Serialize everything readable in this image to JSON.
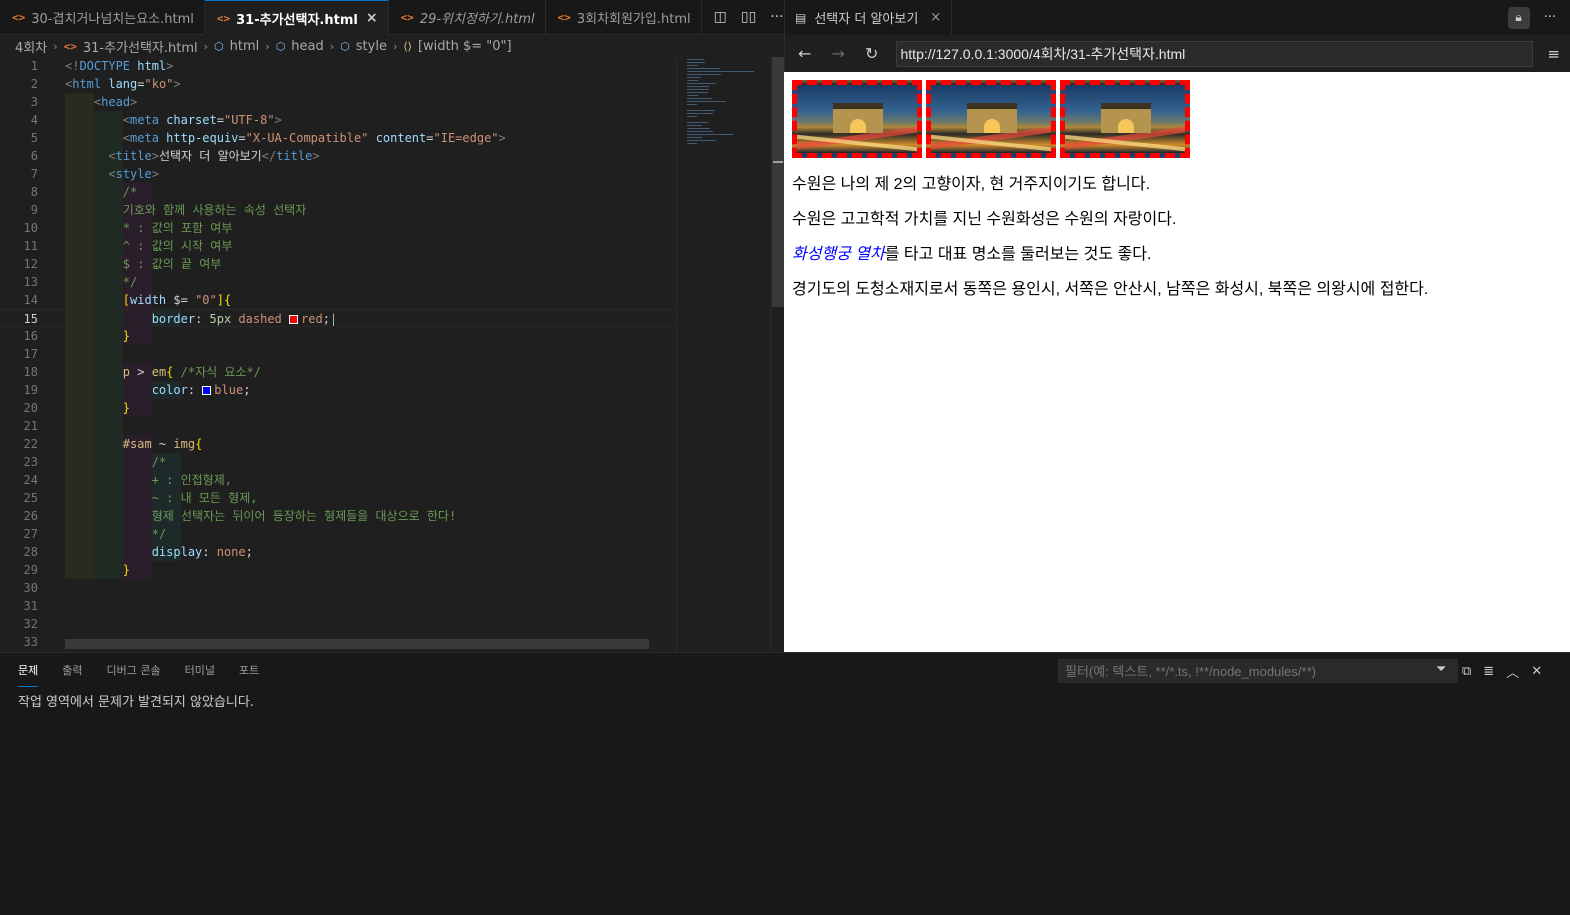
{
  "editor": {
    "tabs": [
      {
        "label": "30-겹치거나넘치는요소.html",
        "active": false,
        "preview": false
      },
      {
        "label": "31-추가선택자.html",
        "active": true,
        "preview": false
      },
      {
        "label": "29-위치정하기.html",
        "active": false,
        "preview": true
      },
      {
        "label": "3회차회원가입.html",
        "active": false,
        "preview": false
      }
    ],
    "tab_icon": "<>",
    "close_glyph": "×",
    "actions": [
      "◫",
      "▯▯",
      "···"
    ],
    "breadcrumb": {
      "folder": "4회차",
      "file": "31-추가선택자.html",
      "html": "html",
      "head": "head",
      "style": "style",
      "selector": "[width $= \"0\"]"
    },
    "current_line": 15,
    "code_lines": [
      [
        [
          "c-punct",
          "<!"
        ],
        [
          "c-tag",
          "DOCTYPE "
        ],
        [
          "c-attr",
          "html"
        ],
        [
          "c-punct",
          ">"
        ]
      ],
      [
        [
          "c-punct",
          "<"
        ],
        [
          "c-tag",
          "html "
        ],
        [
          "c-attr",
          "lang"
        ],
        [
          "c-text",
          "="
        ],
        [
          "c-str",
          "\"ko\""
        ],
        [
          "c-punct",
          ">"
        ]
      ],
      [
        [
          "c-text",
          "    "
        ],
        [
          "c-punct",
          "<"
        ],
        [
          "c-tag",
          "head"
        ],
        [
          "c-punct",
          ">"
        ]
      ],
      [
        [
          "c-text",
          "        "
        ],
        [
          "c-punct",
          "<"
        ],
        [
          "c-tag",
          "meta "
        ],
        [
          "c-attr",
          "charset"
        ],
        [
          "c-text",
          "="
        ],
        [
          "c-str",
          "\"UTF-8\""
        ],
        [
          "c-punct",
          ">"
        ]
      ],
      [
        [
          "c-text",
          "        "
        ],
        [
          "c-punct",
          "<"
        ],
        [
          "c-tag",
          "meta "
        ],
        [
          "c-attr",
          "http-equiv"
        ],
        [
          "c-text",
          "="
        ],
        [
          "c-str",
          "\"X-UA-Compatible\" "
        ],
        [
          "c-attr",
          "content"
        ],
        [
          "c-text",
          "="
        ],
        [
          "c-str",
          "\"IE=edge\""
        ],
        [
          "c-punct",
          ">"
        ]
      ],
      [
        [
          "c-text",
          "      "
        ],
        [
          "c-punct",
          "<"
        ],
        [
          "c-tag",
          "title"
        ],
        [
          "c-punct",
          ">"
        ],
        [
          "c-text",
          "선택자 더 알아보기"
        ],
        [
          "c-punct",
          "</"
        ],
        [
          "c-tag",
          "title"
        ],
        [
          "c-punct",
          ">"
        ]
      ],
      [
        [
          "c-text",
          "      "
        ],
        [
          "c-punct",
          "<"
        ],
        [
          "c-tag",
          "style"
        ],
        [
          "c-punct",
          ">"
        ]
      ],
      [
        [
          "c-text",
          "        "
        ],
        [
          "c-comment",
          "/*"
        ]
      ],
      [
        [
          "c-text",
          "        "
        ],
        [
          "c-comment",
          "기호와 함께 사용하는 속성 선택자"
        ]
      ],
      [
        [
          "c-text",
          "        "
        ],
        [
          "c-comment",
          "* : 값의 포함 여부"
        ]
      ],
      [
        [
          "c-text",
          "        "
        ],
        [
          "c-comment",
          "^ : 값의 시작 여부"
        ]
      ],
      [
        [
          "c-text",
          "        "
        ],
        [
          "c-comment",
          "$ : 값의 끝 여부"
        ]
      ],
      [
        [
          "c-text",
          "        "
        ],
        [
          "c-comment",
          "*/"
        ]
      ],
      [
        [
          "c-text",
          "        "
        ],
        [
          "c-brace",
          "["
        ],
        [
          "c-attr",
          "width"
        ],
        [
          "c-text",
          " $= "
        ],
        [
          "c-str",
          "\"0\""
        ],
        [
          "c-brace",
          "]{"
        ]
      ],
      [
        [
          "c-text",
          "            "
        ],
        [
          "c-prop",
          "border"
        ],
        [
          "c-text",
          ": "
        ],
        [
          "c-num",
          "5px "
        ],
        [
          "c-str",
          "dashed "
        ],
        [
          "swatch-red",
          ""
        ],
        [
          "c-str",
          "red"
        ],
        [
          "c-text",
          ";"
        ]
      ],
      [
        [
          "c-text",
          "        "
        ],
        [
          "c-brace",
          "}"
        ]
      ],
      [],
      [
        [
          "c-text",
          "        "
        ],
        [
          "c-sel",
          "p"
        ],
        [
          "c-text",
          " > "
        ],
        [
          "c-sel",
          "em"
        ],
        [
          "c-brace",
          "{ "
        ],
        [
          "c-comment",
          "/*자식 요소*/"
        ]
      ],
      [
        [
          "c-text",
          "            "
        ],
        [
          "c-prop",
          "color"
        ],
        [
          "c-text",
          ": "
        ],
        [
          "swatch-blue",
          ""
        ],
        [
          "c-str",
          "blue"
        ],
        [
          "c-text",
          ";"
        ]
      ],
      [
        [
          "c-text",
          "        "
        ],
        [
          "c-brace",
          "}"
        ]
      ],
      [],
      [
        [
          "c-text",
          "        "
        ],
        [
          "c-sel",
          "#sam"
        ],
        [
          "c-text",
          " ~ "
        ],
        [
          "c-sel",
          "img"
        ],
        [
          "c-brace",
          "{"
        ]
      ],
      [
        [
          "c-text",
          "            "
        ],
        [
          "c-comment",
          "/*"
        ]
      ],
      [
        [
          "c-text",
          "            "
        ],
        [
          "c-comment",
          "+ : 인접형제,"
        ]
      ],
      [
        [
          "c-text",
          "            "
        ],
        [
          "c-comment",
          "~ : 내 모든 형제,"
        ]
      ],
      [
        [
          "c-text",
          "            "
        ],
        [
          "c-comment",
          "형제 선택자는 뒤이어 등장하는 형제들을 대상으로 한다!"
        ]
      ],
      [
        [
          "c-text",
          "            "
        ],
        [
          "c-comment",
          "*/"
        ]
      ],
      [
        [
          "c-text",
          "            "
        ],
        [
          "c-prop",
          "display"
        ],
        [
          "c-text",
          ": "
        ],
        [
          "c-str",
          "none"
        ],
        [
          "c-text",
          ";"
        ]
      ],
      [
        [
          "c-text",
          "        "
        ],
        [
          "c-brace",
          "}"
        ]
      ],
      [],
      [],
      [],
      []
    ]
  },
  "preview": {
    "tab_title": "선택자 더 알아보기",
    "url": "http://127.0.0.1:3000/4회차/31-추가선택자.html",
    "nav": {
      "back": "←",
      "forward": "→",
      "reload": "↻",
      "menu": "≡",
      "lock": "🔒︎",
      "more": "···"
    },
    "page": {
      "image_count": 3,
      "paragraphs": [
        {
          "em": "",
          "text": "수원은 나의 제 2의 고향이자, 현 거주지이기도 합니다."
        },
        {
          "em": "",
          "text": "수원은 고고학적 가치를 지닌 수원화성은 수원의 자랑이다."
        },
        {
          "em": "화성행궁 열차",
          "text": "를 타고 대표 명소를 둘러보는 것도 좋다."
        },
        {
          "em": "",
          "text": "경기도의 도청소재지로서 동쪽은 용인시, 서쪽은 안산시, 남쪽은 화성시, 북쪽은 의왕시에 접한다."
        }
      ]
    }
  },
  "panel": {
    "tabs": [
      {
        "label": "문제",
        "active": true
      },
      {
        "label": "출력",
        "active": false
      },
      {
        "label": "디버그 콘솔",
        "active": false
      },
      {
        "label": "터미널",
        "active": false
      },
      {
        "label": "포트",
        "active": false
      }
    ],
    "filter_placeholder": "필터(예: 텍스트, **/*.ts, !**/node_modules/**)",
    "message": "작업 영역에서 문제가 발견되지 않았습니다.",
    "actions": [
      "⧉",
      "≣",
      "︿",
      "✕"
    ]
  },
  "colors": {
    "accent": "#0078d4",
    "swatch_red": "#ff0000",
    "swatch_blue": "#0000ff"
  }
}
